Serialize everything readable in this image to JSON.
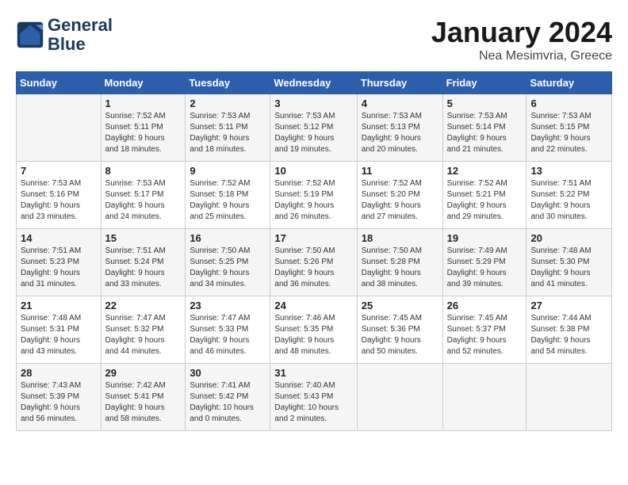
{
  "header": {
    "logo_line1": "General",
    "logo_line2": "Blue",
    "month": "January 2024",
    "location": "Nea Mesimvria, Greece"
  },
  "weekdays": [
    "Sunday",
    "Monday",
    "Tuesday",
    "Wednesday",
    "Thursday",
    "Friday",
    "Saturday"
  ],
  "weeks": [
    [
      {
        "day": "",
        "info": ""
      },
      {
        "day": "1",
        "info": "Sunrise: 7:52 AM\nSunset: 5:11 PM\nDaylight: 9 hours\nand 18 minutes."
      },
      {
        "day": "2",
        "info": "Sunrise: 7:53 AM\nSunset: 5:11 PM\nDaylight: 9 hours\nand 18 minutes."
      },
      {
        "day": "3",
        "info": "Sunrise: 7:53 AM\nSunset: 5:12 PM\nDaylight: 9 hours\nand 19 minutes."
      },
      {
        "day": "4",
        "info": "Sunrise: 7:53 AM\nSunset: 5:13 PM\nDaylight: 9 hours\nand 20 minutes."
      },
      {
        "day": "5",
        "info": "Sunrise: 7:53 AM\nSunset: 5:14 PM\nDaylight: 9 hours\nand 21 minutes."
      },
      {
        "day": "6",
        "info": "Sunrise: 7:53 AM\nSunset: 5:15 PM\nDaylight: 9 hours\nand 22 minutes."
      }
    ],
    [
      {
        "day": "7",
        "info": "Sunrise: 7:53 AM\nSunset: 5:16 PM\nDaylight: 9 hours\nand 23 minutes."
      },
      {
        "day": "8",
        "info": "Sunrise: 7:53 AM\nSunset: 5:17 PM\nDaylight: 9 hours\nand 24 minutes."
      },
      {
        "day": "9",
        "info": "Sunrise: 7:52 AM\nSunset: 5:18 PM\nDaylight: 9 hours\nand 25 minutes."
      },
      {
        "day": "10",
        "info": "Sunrise: 7:52 AM\nSunset: 5:19 PM\nDaylight: 9 hours\nand 26 minutes."
      },
      {
        "day": "11",
        "info": "Sunrise: 7:52 AM\nSunset: 5:20 PM\nDaylight: 9 hours\nand 27 minutes."
      },
      {
        "day": "12",
        "info": "Sunrise: 7:52 AM\nSunset: 5:21 PM\nDaylight: 9 hours\nand 29 minutes."
      },
      {
        "day": "13",
        "info": "Sunrise: 7:51 AM\nSunset: 5:22 PM\nDaylight: 9 hours\nand 30 minutes."
      }
    ],
    [
      {
        "day": "14",
        "info": "Sunrise: 7:51 AM\nSunset: 5:23 PM\nDaylight: 9 hours\nand 31 minutes."
      },
      {
        "day": "15",
        "info": "Sunrise: 7:51 AM\nSunset: 5:24 PM\nDaylight: 9 hours\nand 33 minutes."
      },
      {
        "day": "16",
        "info": "Sunrise: 7:50 AM\nSunset: 5:25 PM\nDaylight: 9 hours\nand 34 minutes."
      },
      {
        "day": "17",
        "info": "Sunrise: 7:50 AM\nSunset: 5:26 PM\nDaylight: 9 hours\nand 36 minutes."
      },
      {
        "day": "18",
        "info": "Sunrise: 7:50 AM\nSunset: 5:28 PM\nDaylight: 9 hours\nand 38 minutes."
      },
      {
        "day": "19",
        "info": "Sunrise: 7:49 AM\nSunset: 5:29 PM\nDaylight: 9 hours\nand 39 minutes."
      },
      {
        "day": "20",
        "info": "Sunrise: 7:48 AM\nSunset: 5:30 PM\nDaylight: 9 hours\nand 41 minutes."
      }
    ],
    [
      {
        "day": "21",
        "info": "Sunrise: 7:48 AM\nSunset: 5:31 PM\nDaylight: 9 hours\nand 43 minutes."
      },
      {
        "day": "22",
        "info": "Sunrise: 7:47 AM\nSunset: 5:32 PM\nDaylight: 9 hours\nand 44 minutes."
      },
      {
        "day": "23",
        "info": "Sunrise: 7:47 AM\nSunset: 5:33 PM\nDaylight: 9 hours\nand 46 minutes."
      },
      {
        "day": "24",
        "info": "Sunrise: 7:46 AM\nSunset: 5:35 PM\nDaylight: 9 hours\nand 48 minutes."
      },
      {
        "day": "25",
        "info": "Sunrise: 7:45 AM\nSunset: 5:36 PM\nDaylight: 9 hours\nand 50 minutes."
      },
      {
        "day": "26",
        "info": "Sunrise: 7:45 AM\nSunset: 5:37 PM\nDaylight: 9 hours\nand 52 minutes."
      },
      {
        "day": "27",
        "info": "Sunrise: 7:44 AM\nSunset: 5:38 PM\nDaylight: 9 hours\nand 54 minutes."
      }
    ],
    [
      {
        "day": "28",
        "info": "Sunrise: 7:43 AM\nSunset: 5:39 PM\nDaylight: 9 hours\nand 56 minutes."
      },
      {
        "day": "29",
        "info": "Sunrise: 7:42 AM\nSunset: 5:41 PM\nDaylight: 9 hours\nand 58 minutes."
      },
      {
        "day": "30",
        "info": "Sunrise: 7:41 AM\nSunset: 5:42 PM\nDaylight: 10 hours\nand 0 minutes."
      },
      {
        "day": "31",
        "info": "Sunrise: 7:40 AM\nSunset: 5:43 PM\nDaylight: 10 hours\nand 2 minutes."
      },
      {
        "day": "",
        "info": ""
      },
      {
        "day": "",
        "info": ""
      },
      {
        "day": "",
        "info": ""
      }
    ]
  ]
}
